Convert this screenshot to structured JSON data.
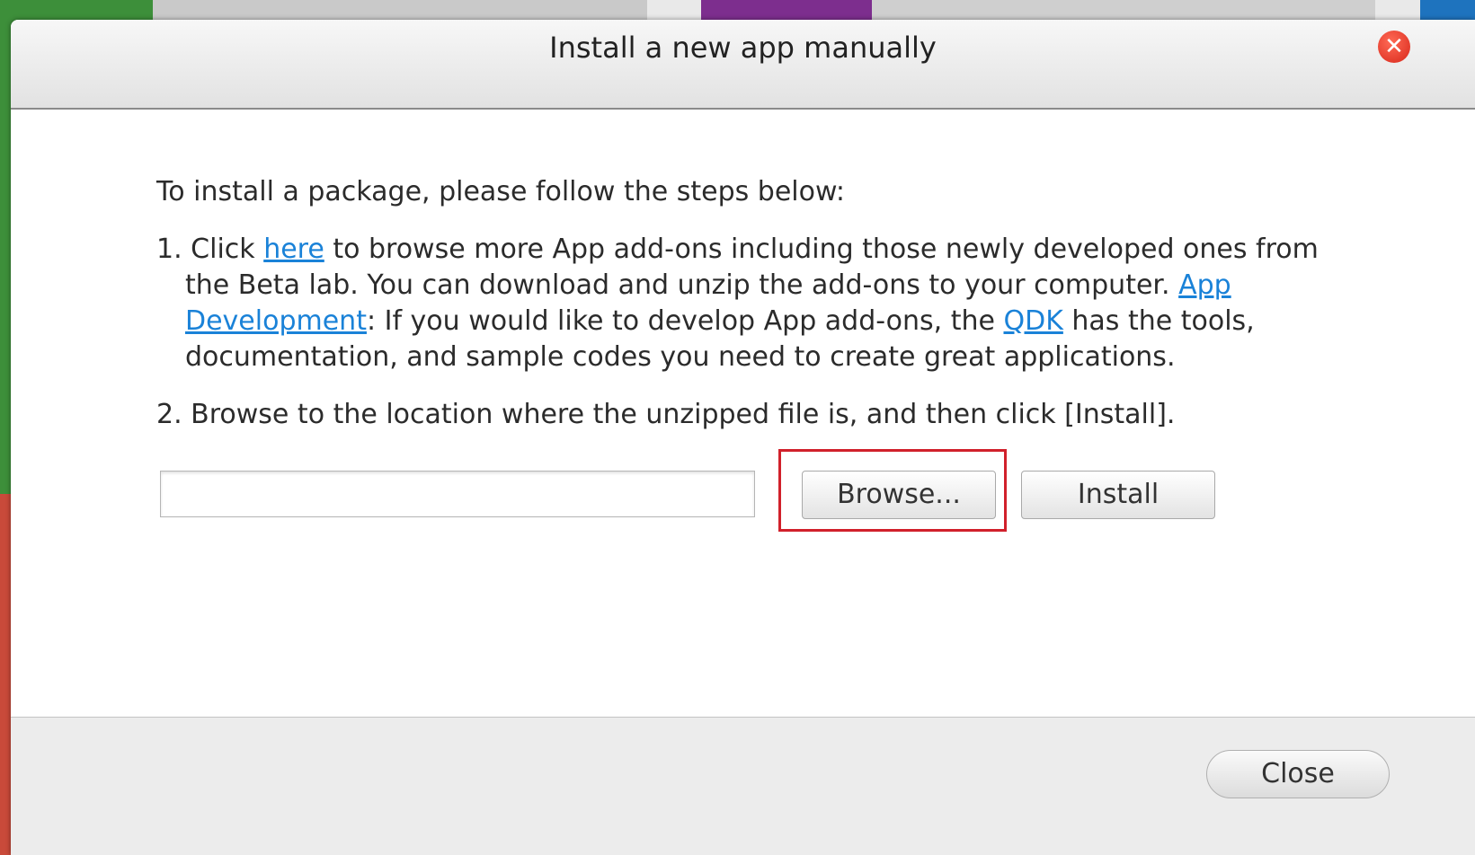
{
  "dialog": {
    "title": "Install a new app manually",
    "close_icon": "close-x-icon"
  },
  "instructions": {
    "intro": "To install a package, please follow the steps below:",
    "step1": {
      "prefix": "1. Click ",
      "here_link": "here",
      "text_a": " to browse more App add-ons including those newly developed ones from the Beta lab. You can download and unzip the add-ons to your computer. ",
      "app_dev_link": "App Development",
      "text_b": ": If you would like to develop App add-ons, the ",
      "qdk_link": "QDK",
      "text_c": " has the tools, documentation, and sample codes you need to create great applications."
    },
    "step2": "2. Browse to the location where the unzipped file is, and then click [Install]."
  },
  "form": {
    "file_path_value": "",
    "browse_label": "Browse...",
    "install_label": "Install"
  },
  "footer": {
    "close_label": "Close"
  },
  "colors": {
    "link": "#1a82d8",
    "highlight": "#d1202b",
    "close_icon": "#e0301f"
  }
}
